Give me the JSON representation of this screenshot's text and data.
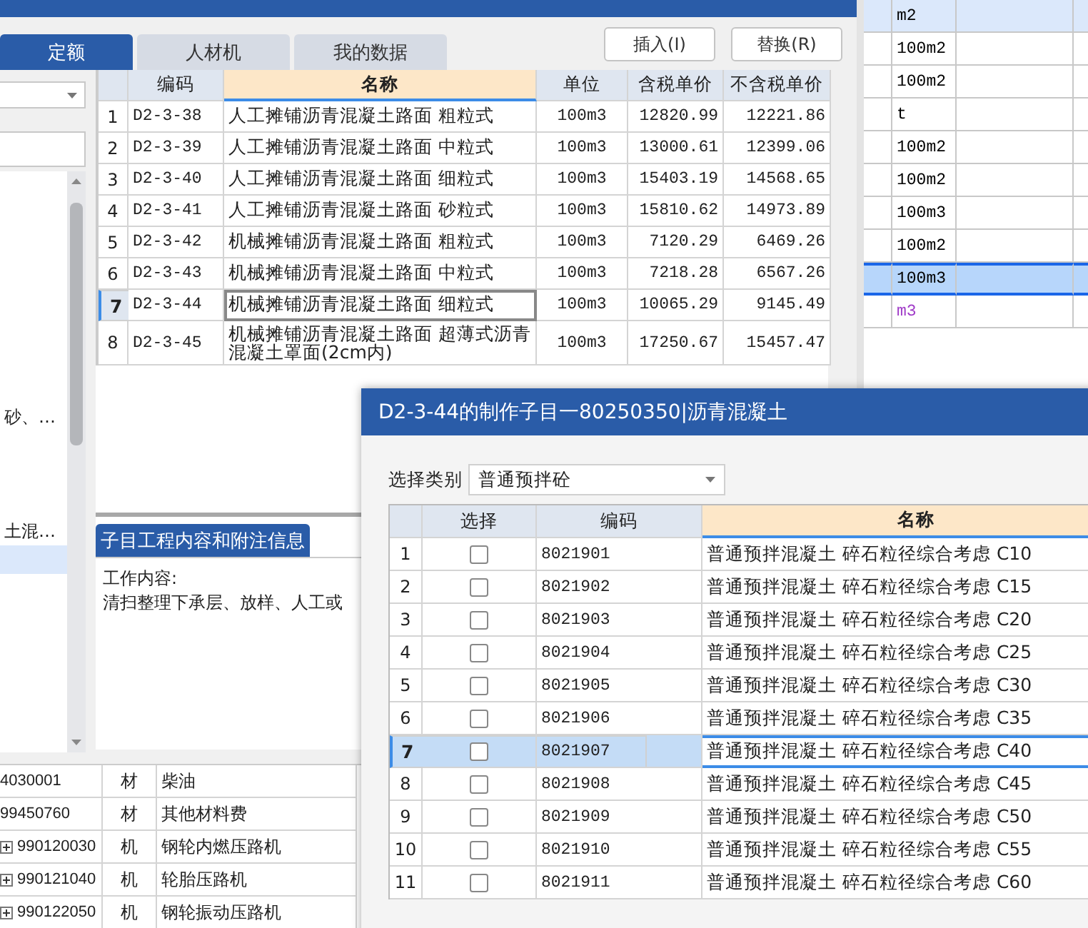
{
  "tabs": [
    {
      "label": "定额",
      "selected": true
    },
    {
      "label": "人材机",
      "selected": false
    },
    {
      "label": "我的数据",
      "selected": false
    }
  ],
  "buttons": [
    "插入(I)",
    "替换(R)"
  ],
  "tree": {
    "items": [
      {
        "label": "砂、…",
        "selected": false
      },
      {
        "label": "土混…",
        "selected": false
      },
      {
        "selected": true
      }
    ]
  },
  "quota_table": {
    "columns": [
      {
        "label": "编码",
        "highlighted": false
      },
      {
        "label": "名称",
        "highlighted": true
      },
      {
        "label": "单位",
        "highlighted": false
      },
      {
        "label": "含税单价",
        "highlighted": false
      },
      {
        "label": "不含税单价",
        "highlighted": false
      }
    ],
    "rows": [
      {
        "index": "1",
        "code": "D2-3-38",
        "name": "人工摊铺沥青混凝土路面 粗粒式",
        "unit": "100m3",
        "price_with_tax": "12820.99",
        "price_without_tax": "12221.86",
        "selected": false
      },
      {
        "index": "2",
        "code": "D2-3-39",
        "name": "人工摊铺沥青混凝土路面 中粒式",
        "unit": "100m3",
        "price_with_tax": "13000.61",
        "price_without_tax": "12399.06",
        "selected": false
      },
      {
        "index": "3",
        "code": "D2-3-40",
        "name": "人工摊铺沥青混凝土路面 细粒式",
        "unit": "100m3",
        "price_with_tax": "15403.19",
        "price_without_tax": "14568.65",
        "selected": false
      },
      {
        "index": "4",
        "code": "D2-3-41",
        "name": "人工摊铺沥青混凝土路面 砂粒式",
        "unit": "100m3",
        "price_with_tax": "15810.62",
        "price_without_tax": "14973.89",
        "selected": false
      },
      {
        "index": "5",
        "code": "D2-3-42",
        "name": "机械摊铺沥青混凝土路面 粗粒式",
        "unit": "100m3",
        "price_with_tax": "7120.29",
        "price_without_tax": "6469.26",
        "selected": false
      },
      {
        "index": "6",
        "code": "D2-3-43",
        "name": "机械摊铺沥青混凝土路面 中粒式",
        "unit": "100m3",
        "price_with_tax": "7218.28",
        "price_without_tax": "6567.26",
        "selected": false
      },
      {
        "index": "7",
        "code": "D2-3-44",
        "name": "机械摊铺沥青混凝土路面 细粒式",
        "unit": "100m3",
        "price_with_tax": "10065.29",
        "price_without_tax": "9145.49",
        "selected": true
      },
      {
        "index": "8",
        "code": "D2-3-45",
        "name": "机械摊铺沥青混凝土路面 超薄式沥青混凝土罩面(2cm内)",
        "unit": "100m3",
        "price_with_tax": "17250.67",
        "price_without_tax": "15457.47",
        "selected": false
      }
    ]
  },
  "info_panel": {
    "tab": "子目工程内容和附注信息",
    "heading": "工作内容:",
    "text": "清扫整理下承层、放样、人工或"
  },
  "unit_table": {
    "rows": [
      {
        "unit": "m2",
        "highlighted": true,
        "selected": false,
        "color": "#000000"
      },
      {
        "unit": "100m2",
        "highlighted": false,
        "selected": false,
        "color": "#000000"
      },
      {
        "unit": "100m2",
        "highlighted": false,
        "selected": false,
        "color": "#000000"
      },
      {
        "unit": "t",
        "highlighted": false,
        "selected": false,
        "color": "#000000"
      },
      {
        "unit": "100m2",
        "highlighted": false,
        "selected": false,
        "color": "#000000"
      },
      {
        "unit": "100m2",
        "highlighted": false,
        "selected": false,
        "color": "#000000"
      },
      {
        "unit": "100m3",
        "highlighted": false,
        "selected": false,
        "color": "#000000"
      },
      {
        "unit": "100m2",
        "highlighted": false,
        "selected": false,
        "color": "#000000"
      },
      {
        "unit": "100m3",
        "highlighted": false,
        "selected": true,
        "color": "#000000"
      },
      {
        "unit": "m3",
        "highlighted": false,
        "selected": false,
        "color": "#a03cc8"
      }
    ]
  },
  "resource_table": {
    "rows": [
      {
        "code": "4030001",
        "type": "材",
        "name": "柴油",
        "expandable": false
      },
      {
        "code": "99450760",
        "type": "材",
        "name": "其他材料费",
        "expandable": false
      },
      {
        "code": "990120030",
        "type": "机",
        "name": "钢轮内燃压路机",
        "expandable": true
      },
      {
        "code": "990121040",
        "type": "机",
        "name": "轮胎压路机",
        "expandable": true
      },
      {
        "code": "990122050",
        "type": "机",
        "name": "钢轮振动压路机",
        "expandable": true
      }
    ]
  },
  "dialog": {
    "title": "D2-3-44的制作子目一80250350|沥青混凝土",
    "category_label": "选择类别",
    "category_value": "普通预拌砼",
    "columns": [
      {
        "label": "选择",
        "highlighted": false
      },
      {
        "label": "编码",
        "highlighted": false
      },
      {
        "label": "名称",
        "highlighted": true
      }
    ],
    "rows": [
      {
        "index": "1",
        "checked": false,
        "code": "8021901",
        "name": "普通预拌混凝土 碎石粒径综合考虑 C10",
        "selected": false
      },
      {
        "index": "2",
        "checked": false,
        "code": "8021902",
        "name": "普通预拌混凝土 碎石粒径综合考虑 C15",
        "selected": false
      },
      {
        "index": "3",
        "checked": false,
        "code": "8021903",
        "name": "普通预拌混凝土 碎石粒径综合考虑 C20",
        "selected": false
      },
      {
        "index": "4",
        "checked": false,
        "code": "8021904",
        "name": "普通预拌混凝土 碎石粒径综合考虑 C25",
        "selected": false
      },
      {
        "index": "5",
        "checked": false,
        "code": "8021905",
        "name": "普通预拌混凝土 碎石粒径综合考虑 C30",
        "selected": false
      },
      {
        "index": "6",
        "checked": false,
        "code": "8021906",
        "name": "普通预拌混凝土 碎石粒径综合考虑 C35",
        "selected": false
      },
      {
        "index": "7",
        "checked": false,
        "code": "8021907",
        "name": "普通预拌混凝土 碎石粒径综合考虑 C40",
        "selected": true
      },
      {
        "index": "8",
        "checked": false,
        "code": "8021908",
        "name": "普通预拌混凝土 碎石粒径综合考虑 C45",
        "selected": false
      },
      {
        "index": "9",
        "checked": false,
        "code": "8021909",
        "name": "普通预拌混凝土 碎石粒径综合考虑 C50",
        "selected": false
      },
      {
        "index": "10",
        "checked": false,
        "code": "8021910",
        "name": "普通预拌混凝土 碎石粒径综合考虑 C55",
        "selected": false
      },
      {
        "index": "11",
        "checked": false,
        "code": "8021911",
        "name": "普通预拌混凝土 碎石粒径综合考虑 C60",
        "selected": false
      }
    ]
  }
}
